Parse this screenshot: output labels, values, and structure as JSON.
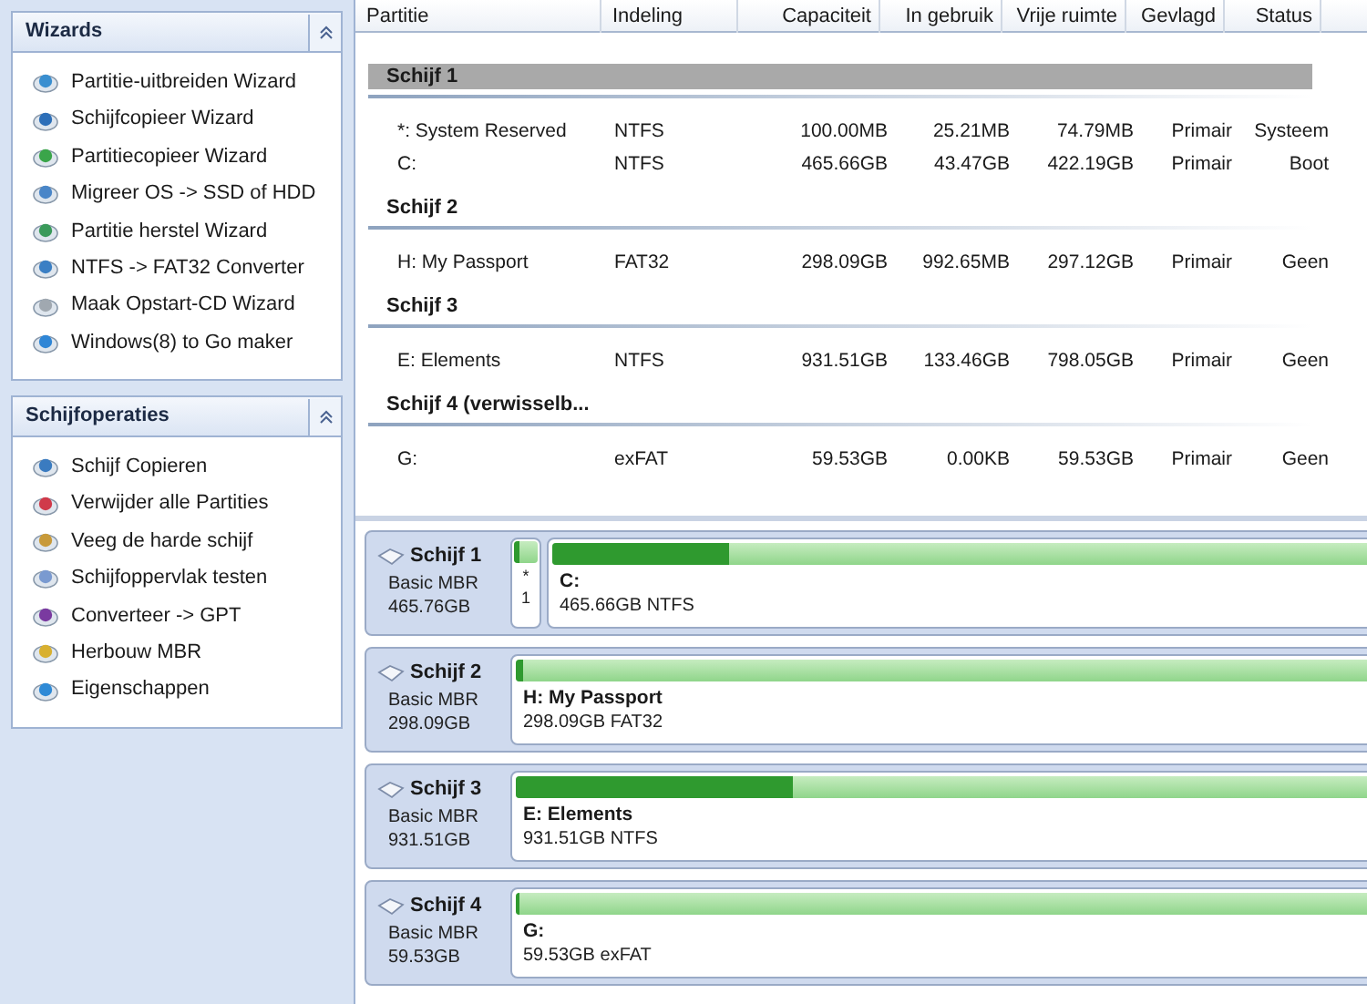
{
  "sidebar": {
    "panels": [
      {
        "title": "Wizards",
        "expanded": true,
        "items": [
          "Partitie-uitbreiden Wizard",
          "Schijfcopieer Wizard",
          "Partitiecopieer Wizard",
          "Migreer OS -> SSD of HDD",
          "Partitie herstel Wizard",
          "NTFS -> FAT32 Converter",
          "Maak Opstart-CD Wizard",
          "Windows(8) to Go maker"
        ]
      },
      {
        "title": "Schijfoperaties",
        "expanded": true,
        "items": [
          "Schijf Copieren",
          "Verwijder alle Partities",
          "Veeg de harde schijf",
          "Schijfoppervlak testen",
          "Converteer -> GPT",
          "Herbouw MBR",
          "Eigenschappen"
        ]
      }
    ]
  },
  "table": {
    "columns": [
      "Partitie",
      "Indeling",
      "Capaciteit",
      "In gebruik",
      "Vrije ruimte",
      "Gevlagd",
      "Status"
    ],
    "groups": [
      {
        "title": "Schijf 1",
        "selected": true,
        "rows": [
          [
            "*: System Reserved",
            "NTFS",
            "100.00MB",
            "25.21MB",
            "74.79MB",
            "Primair",
            "Systeem"
          ],
          [
            "C:",
            "NTFS",
            "465.66GB",
            "43.47GB",
            "422.19GB",
            "Primair",
            "Boot"
          ]
        ]
      },
      {
        "title": "Schijf 2",
        "selected": false,
        "rows": [
          [
            "H: My Passport",
            "FAT32",
            "298.09GB",
            "992.65MB",
            "297.12GB",
            "Primair",
            "Geen"
          ]
        ]
      },
      {
        "title": "Schijf 3",
        "selected": false,
        "rows": [
          [
            "E: Elements",
            "NTFS",
            "931.51GB",
            "133.46GB",
            "798.05GB",
            "Primair",
            "Geen"
          ]
        ]
      },
      {
        "title": "Schijf 4 (verwisselb...",
        "selected": false,
        "rows": [
          [
            "G:",
            "exFAT",
            "59.53GB",
            "0.00KB",
            "59.53GB",
            "Primair",
            "Geen"
          ]
        ]
      }
    ]
  },
  "disk_map": [
    {
      "name": "Schijf 1",
      "type": "Basic MBR",
      "size": "465.76GB",
      "partitions": [
        {
          "kind": "small",
          "name": "*",
          "info": "1",
          "level": 0.25
        },
        {
          "kind": "main",
          "name": "C:",
          "info": "465.66GB NTFS",
          "level": 0.093
        }
      ]
    },
    {
      "name": "Schijf 2",
      "type": "Basic MBR",
      "size": "298.09GB",
      "partitions": [
        {
          "kind": "main",
          "name": "H: My Passport",
          "info": "298.09GB FAT32",
          "level": 0.004
        }
      ]
    },
    {
      "name": "Schijf 3",
      "type": "Basic MBR",
      "size": "931.51GB",
      "partitions": [
        {
          "kind": "main",
          "name": "E: Elements",
          "info": "931.51GB NTFS",
          "level": 0.143
        }
      ]
    },
    {
      "name": "Schijf 4",
      "type": "Basic MBR",
      "size": "59.53GB",
      "partitions": [
        {
          "kind": "main",
          "name": "G:",
          "info": "59.53GB exFAT",
          "level": 0.002
        }
      ]
    }
  ]
}
